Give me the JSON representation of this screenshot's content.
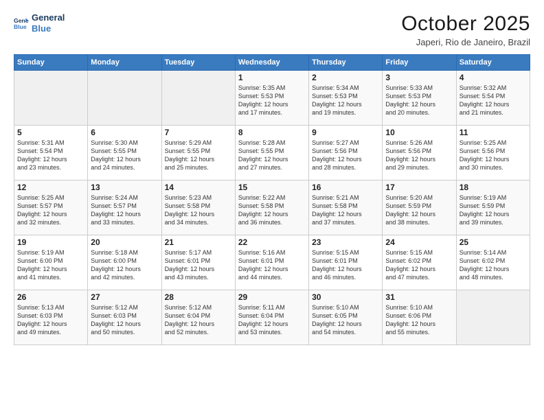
{
  "logo": {
    "line1": "General",
    "line2": "Blue"
  },
  "title": "October 2025",
  "location": "Japeri, Rio de Janeiro, Brazil",
  "headers": [
    "Sunday",
    "Monday",
    "Tuesday",
    "Wednesday",
    "Thursday",
    "Friday",
    "Saturday"
  ],
  "weeks": [
    [
      {
        "day": "",
        "info": ""
      },
      {
        "day": "",
        "info": ""
      },
      {
        "day": "",
        "info": ""
      },
      {
        "day": "1",
        "info": "Sunrise: 5:35 AM\nSunset: 5:53 PM\nDaylight: 12 hours\nand 17 minutes."
      },
      {
        "day": "2",
        "info": "Sunrise: 5:34 AM\nSunset: 5:53 PM\nDaylight: 12 hours\nand 19 minutes."
      },
      {
        "day": "3",
        "info": "Sunrise: 5:33 AM\nSunset: 5:53 PM\nDaylight: 12 hours\nand 20 minutes."
      },
      {
        "day": "4",
        "info": "Sunrise: 5:32 AM\nSunset: 5:54 PM\nDaylight: 12 hours\nand 21 minutes."
      }
    ],
    [
      {
        "day": "5",
        "info": "Sunrise: 5:31 AM\nSunset: 5:54 PM\nDaylight: 12 hours\nand 23 minutes."
      },
      {
        "day": "6",
        "info": "Sunrise: 5:30 AM\nSunset: 5:55 PM\nDaylight: 12 hours\nand 24 minutes."
      },
      {
        "day": "7",
        "info": "Sunrise: 5:29 AM\nSunset: 5:55 PM\nDaylight: 12 hours\nand 25 minutes."
      },
      {
        "day": "8",
        "info": "Sunrise: 5:28 AM\nSunset: 5:55 PM\nDaylight: 12 hours\nand 27 minutes."
      },
      {
        "day": "9",
        "info": "Sunrise: 5:27 AM\nSunset: 5:56 PM\nDaylight: 12 hours\nand 28 minutes."
      },
      {
        "day": "10",
        "info": "Sunrise: 5:26 AM\nSunset: 5:56 PM\nDaylight: 12 hours\nand 29 minutes."
      },
      {
        "day": "11",
        "info": "Sunrise: 5:25 AM\nSunset: 5:56 PM\nDaylight: 12 hours\nand 30 minutes."
      }
    ],
    [
      {
        "day": "12",
        "info": "Sunrise: 5:25 AM\nSunset: 5:57 PM\nDaylight: 12 hours\nand 32 minutes."
      },
      {
        "day": "13",
        "info": "Sunrise: 5:24 AM\nSunset: 5:57 PM\nDaylight: 12 hours\nand 33 minutes."
      },
      {
        "day": "14",
        "info": "Sunrise: 5:23 AM\nSunset: 5:58 PM\nDaylight: 12 hours\nand 34 minutes."
      },
      {
        "day": "15",
        "info": "Sunrise: 5:22 AM\nSunset: 5:58 PM\nDaylight: 12 hours\nand 36 minutes."
      },
      {
        "day": "16",
        "info": "Sunrise: 5:21 AM\nSunset: 5:58 PM\nDaylight: 12 hours\nand 37 minutes."
      },
      {
        "day": "17",
        "info": "Sunrise: 5:20 AM\nSunset: 5:59 PM\nDaylight: 12 hours\nand 38 minutes."
      },
      {
        "day": "18",
        "info": "Sunrise: 5:19 AM\nSunset: 5:59 PM\nDaylight: 12 hours\nand 39 minutes."
      }
    ],
    [
      {
        "day": "19",
        "info": "Sunrise: 5:19 AM\nSunset: 6:00 PM\nDaylight: 12 hours\nand 41 minutes."
      },
      {
        "day": "20",
        "info": "Sunrise: 5:18 AM\nSunset: 6:00 PM\nDaylight: 12 hours\nand 42 minutes."
      },
      {
        "day": "21",
        "info": "Sunrise: 5:17 AM\nSunset: 6:01 PM\nDaylight: 12 hours\nand 43 minutes."
      },
      {
        "day": "22",
        "info": "Sunrise: 5:16 AM\nSunset: 6:01 PM\nDaylight: 12 hours\nand 44 minutes."
      },
      {
        "day": "23",
        "info": "Sunrise: 5:15 AM\nSunset: 6:01 PM\nDaylight: 12 hours\nand 46 minutes."
      },
      {
        "day": "24",
        "info": "Sunrise: 5:15 AM\nSunset: 6:02 PM\nDaylight: 12 hours\nand 47 minutes."
      },
      {
        "day": "25",
        "info": "Sunrise: 5:14 AM\nSunset: 6:02 PM\nDaylight: 12 hours\nand 48 minutes."
      }
    ],
    [
      {
        "day": "26",
        "info": "Sunrise: 5:13 AM\nSunset: 6:03 PM\nDaylight: 12 hours\nand 49 minutes."
      },
      {
        "day": "27",
        "info": "Sunrise: 5:12 AM\nSunset: 6:03 PM\nDaylight: 12 hours\nand 50 minutes."
      },
      {
        "day": "28",
        "info": "Sunrise: 5:12 AM\nSunset: 6:04 PM\nDaylight: 12 hours\nand 52 minutes."
      },
      {
        "day": "29",
        "info": "Sunrise: 5:11 AM\nSunset: 6:04 PM\nDaylight: 12 hours\nand 53 minutes."
      },
      {
        "day": "30",
        "info": "Sunrise: 5:10 AM\nSunset: 6:05 PM\nDaylight: 12 hours\nand 54 minutes."
      },
      {
        "day": "31",
        "info": "Sunrise: 5:10 AM\nSunset: 6:06 PM\nDaylight: 12 hours\nand 55 minutes."
      },
      {
        "day": "",
        "info": ""
      }
    ]
  ]
}
